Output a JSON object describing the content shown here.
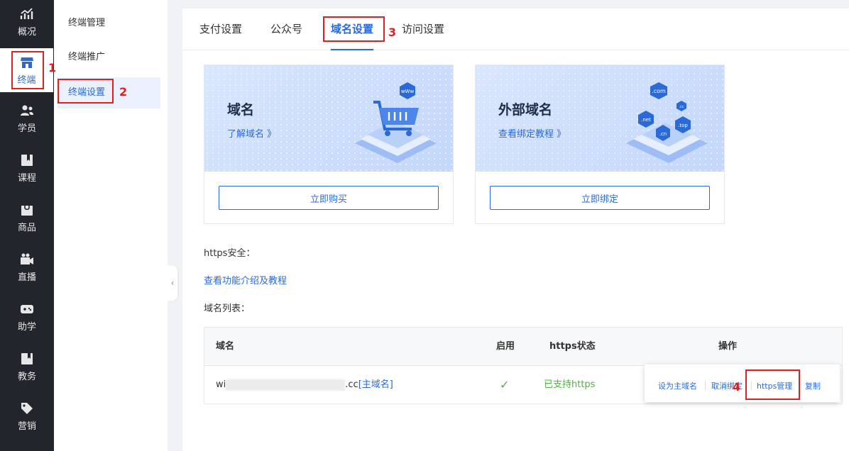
{
  "rail": {
    "items": [
      {
        "label": "概况",
        "icon": "chart-trend-icon"
      },
      {
        "label": "终端",
        "icon": "storefront-icon"
      },
      {
        "label": "学员",
        "icon": "users-icon"
      },
      {
        "label": "课程",
        "icon": "book-icon"
      },
      {
        "label": "商品",
        "icon": "shopping-bag-icon"
      },
      {
        "label": "直播",
        "icon": "video-camera-icon"
      },
      {
        "label": "助学",
        "icon": "gamepad-icon"
      },
      {
        "label": "教务",
        "icon": "bookmark-book-icon"
      },
      {
        "label": "营销",
        "icon": "tag-icon"
      }
    ]
  },
  "submenu": {
    "items": [
      {
        "label": "终端管理"
      },
      {
        "label": "终端推广"
      },
      {
        "label": "终端设置"
      }
    ]
  },
  "tabs": [
    {
      "label": "支付设置"
    },
    {
      "label": "公众号"
    },
    {
      "label": "域名设置"
    },
    {
      "label": "访问设置"
    }
  ],
  "cards": [
    {
      "title": "域名",
      "link": "了解域名 》",
      "button": "立即购买",
      "badge": "wWw"
    },
    {
      "title": "外部域名",
      "link": "查看绑定教程 》",
      "button": "立即绑定",
      "badges": [
        ".com",
        ".cc",
        ".net",
        ".top",
        ".cn"
      ]
    }
  ],
  "https_section": {
    "label": "https安全：",
    "link": "查看功能介绍及教程"
  },
  "domain_list": {
    "label": "域名列表：",
    "headers": {
      "domain": "域名",
      "enabled": "启用",
      "https_status": "https状态",
      "actions": "操作"
    },
    "rows": [
      {
        "domain_prefix": "wi",
        "domain_suffix": ".cc",
        "primary_tag": "[主域名]",
        "enabled_mark": "✓",
        "https_status": "已支持https"
      }
    ]
  },
  "actions": {
    "set_primary": "设为主域名",
    "cancel_binding": "取消绑定",
    "https_manage": "https管理",
    "copy": "复制"
  },
  "annotations": [
    "1",
    "2",
    "3",
    "4"
  ],
  "colors": {
    "accent": "#2a6ad8",
    "rail_bg": "#22252b",
    "success": "#52b043",
    "annotation": "#e02020"
  }
}
